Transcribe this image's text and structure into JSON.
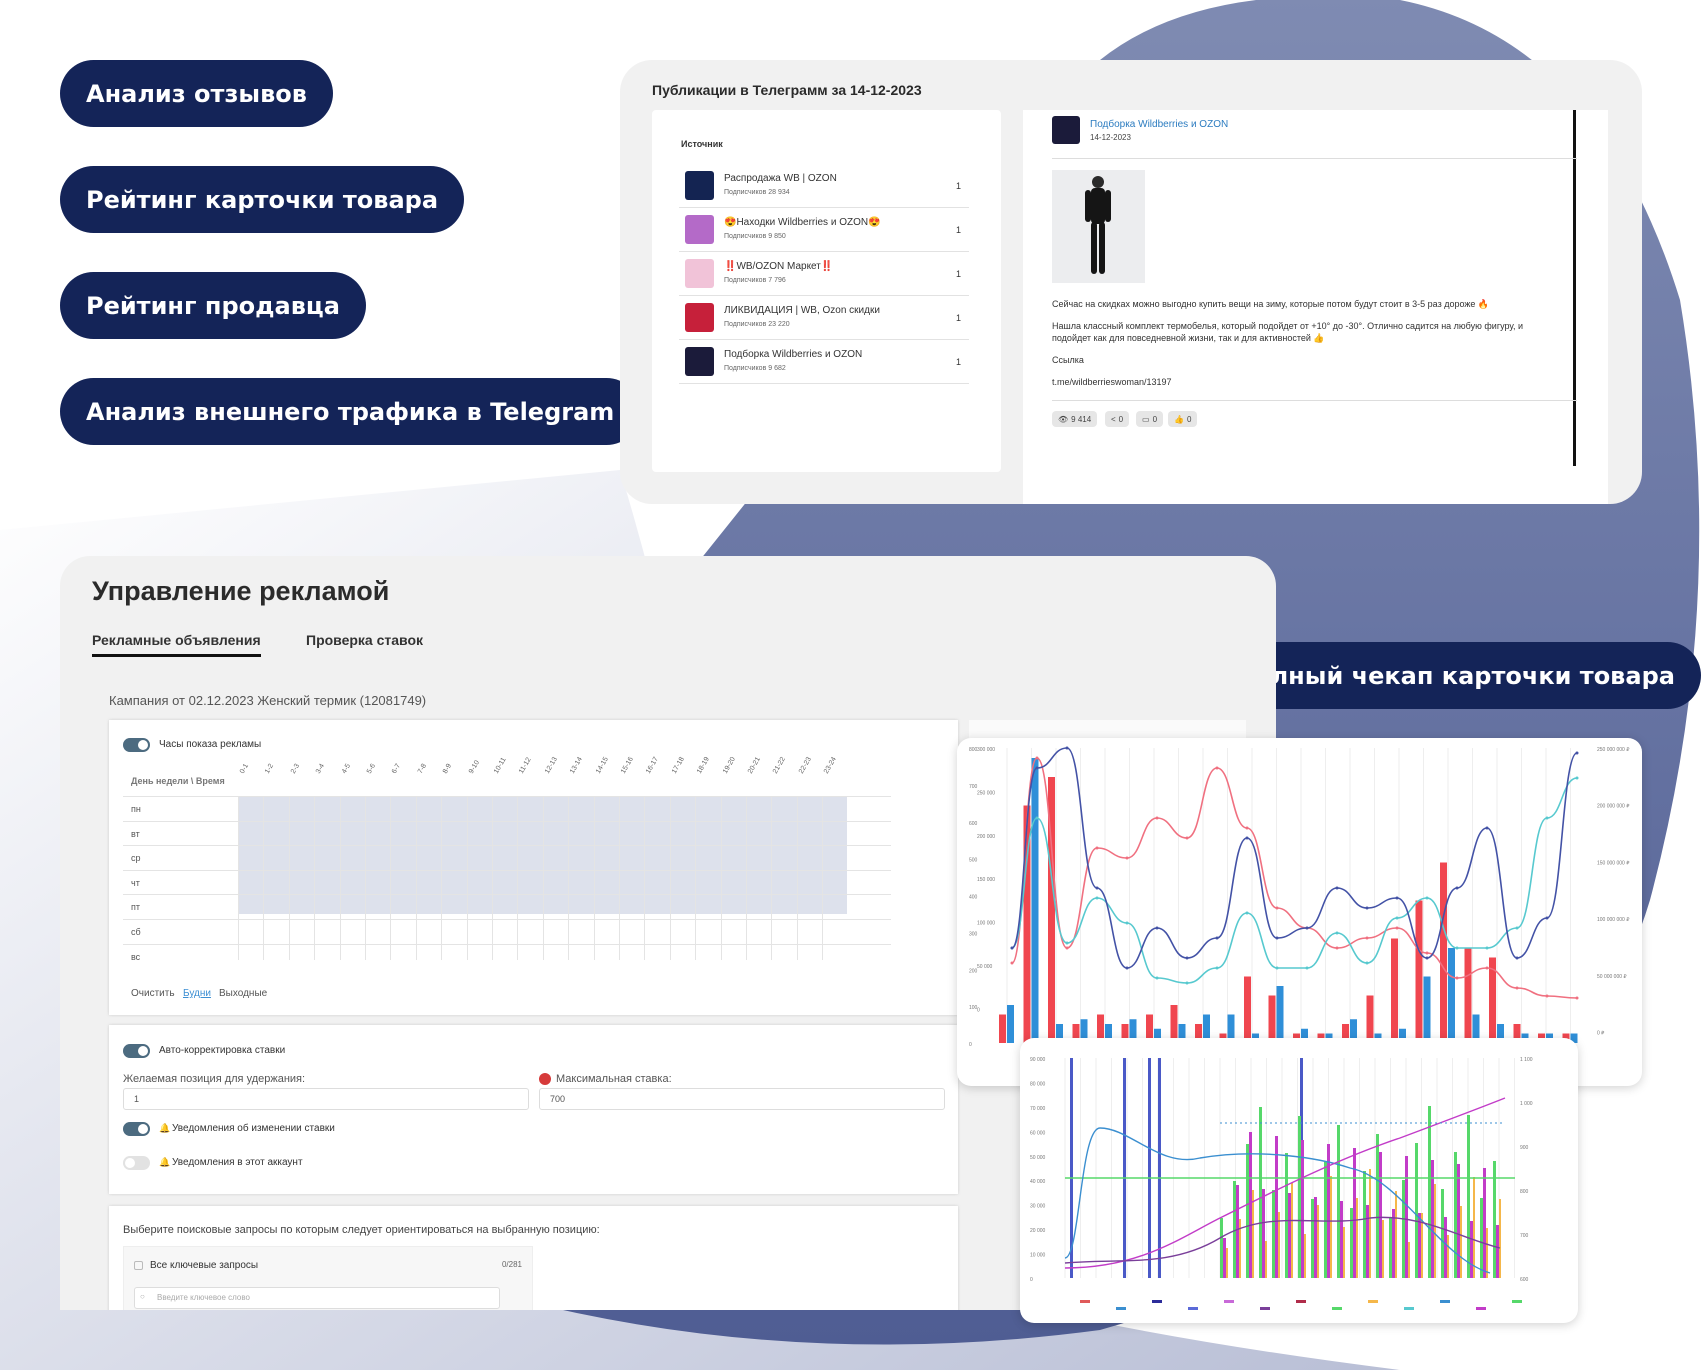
{
  "features": {
    "reviews": "Анализ отзывов",
    "card_rating": "Рейтинг карточки товара",
    "seller_rating": "Рейтинг продавца",
    "telegram_traffic": "Анализ внешнего трафика в Telegram",
    "full_checkup": "Полный чекап карточки товара"
  },
  "telegram": {
    "title": "Публикации в Телеграмм за 14-12-2023",
    "source_header": "Источник",
    "sources": [
      {
        "name": "Распродажа WB | OZON",
        "subs": "Подписчиков 28 934",
        "count": "1",
        "color": "#142452"
      },
      {
        "name": "😍Находки Wildberries и OZON😍",
        "subs": "Подписчиков 9 850",
        "count": "1",
        "color": "#b46ac8"
      },
      {
        "name": "‼️WB/OZON Маркет‼️",
        "subs": "Подписчиков 7 796",
        "count": "1",
        "color": "#f1c3d8"
      },
      {
        "name": "ЛИКВИДАЦИЯ | WB, Ozon скидки",
        "subs": "Подписчиков 23 220",
        "count": "1",
        "color": "#c6203a"
      },
      {
        "name": "Подборка Wildberries и OZON",
        "subs": "Подписчиков 9 682",
        "count": "1",
        "color": "#1b1b3a"
      }
    ],
    "post": {
      "channel": "Подборка Wildberries и OZON",
      "date": "14-12-2023",
      "text1": "Сейчас на скидках можно выгодно купить вещи на зиму, которые потом будут стоит в 3-5 раз дороже 🔥",
      "text2": "Нашла классный комплект термобелья, который подойдет от +10° до -30°. Отлично садится на любую фигуру, и подойдет как для повседневной жизни, так и для активностей 👍",
      "link_label": "Ссылка",
      "link": "t.me/wildberrieswoman/13197",
      "views": "9 414",
      "shares": "0",
      "comments": "0",
      "likes": "0"
    }
  },
  "ads": {
    "title": "Управление рекламой",
    "tabs": [
      "Рекламные объявления",
      "Проверка ставок"
    ],
    "campaign": "Кампания от 02.12.2023 Женский термик (12081749)",
    "hours_toggle": "Часы показа рекламы",
    "grid_header": "День недели \\ Время",
    "hours": [
      "0-1",
      "1-2",
      "2-3",
      "3-4",
      "4-5",
      "5-6",
      "6-7",
      "7-8",
      "8-9",
      "9-10",
      "10-11",
      "11-12",
      "12-13",
      "13-14",
      "14-15",
      "15-16",
      "16-17",
      "17-18",
      "18-19",
      "19-20",
      "20-21",
      "21-22",
      "22-23",
      "23-24"
    ],
    "days": [
      "пн",
      "вт",
      "ср",
      "чт",
      "пт",
      "сб",
      "вс"
    ],
    "clear": "Очистить",
    "weekdays": "Будни",
    "weekends": "Выходные",
    "auto_bid": "Авто-корректировка ставки",
    "position_label": "Желаемая позиция для удержания:",
    "position_value": "1",
    "max_bid_label": "Максимальная ставка:",
    "max_bid_value": "700",
    "notify_bid": "Уведомления об изменении ставки",
    "notify_account": "Уведомления в этот аккаунт",
    "queries_label": "Выберите поисковые запросы по которым следует ориентироваться на выбранную позицию:",
    "all_keywords": "Все ключевые запросы",
    "keywords_count": "0/281",
    "keyword_placeholder": "Введите ключевое слово"
  },
  "chart1": {
    "left_ticks": [
      "800",
      "700",
      "600",
      "500",
      "400",
      "300",
      "200",
      "100",
      "0"
    ],
    "mid_ticks": [
      "300 000",
      "250 000",
      "200 000",
      "150 000",
      "100 000",
      "50 000",
      "0"
    ],
    "right_ticks": [
      "250 000 000 ₽",
      "200 000 000 ₽",
      "150 000 000 ₽",
      "100 000 000 ₽",
      "50 000 000 ₽",
      "0 ₽"
    ],
    "colors": {
      "red": "#f0464f",
      "blue": "#2f8fd8",
      "navy": "#4352a6",
      "pink": "#f07080",
      "teal": "#57c9cf"
    }
  },
  "chart2": {
    "left_ticks": [
      "90 000",
      "80 000",
      "70 000",
      "60 000",
      "50 000",
      "40 000",
      "30 000",
      "20 000",
      "10 000",
      "0"
    ],
    "right_ticks": [
      "1 100",
      "1 000",
      "900",
      "800",
      "700",
      "600"
    ],
    "colors": {
      "navy": "#4a59c7",
      "blue": "#3b8fd0",
      "green": "#56d86a",
      "magenta": "#c23cc8",
      "purple": "#7a3f9a",
      "orange": "#f5b74a"
    }
  }
}
